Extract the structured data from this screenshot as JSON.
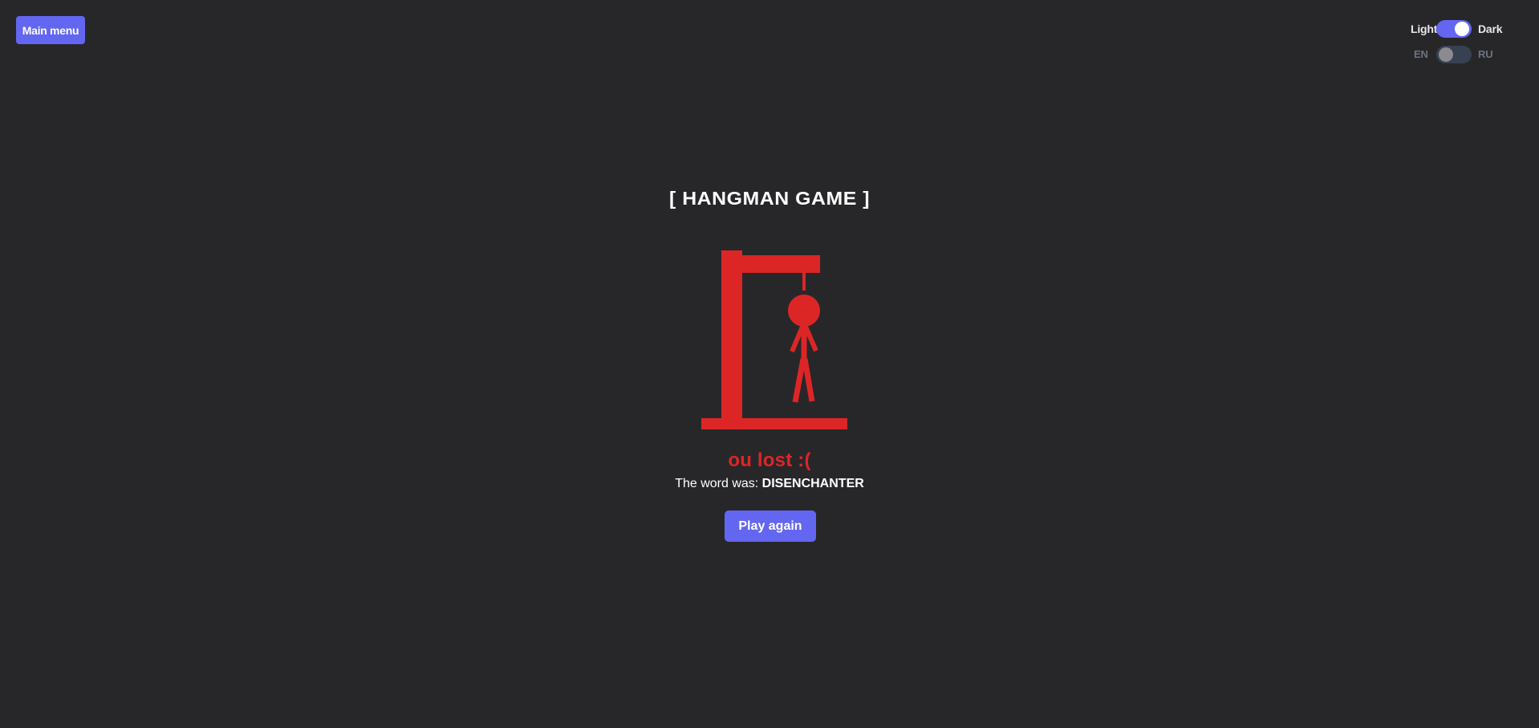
{
  "nav": {
    "main_menu_label": "Main menu"
  },
  "theme_toggle": {
    "left_label": "Light",
    "right_label": "Dark",
    "state": "dark"
  },
  "language_toggle": {
    "left_label": "EN",
    "right_label": "RU",
    "state": "en"
  },
  "game": {
    "title": "[ HANGMAN GAME ]",
    "result_message": "ou lost :(",
    "word_prefix": "The word was: ",
    "word": "DISENCHANTER",
    "play_again_label": "Play again",
    "hangman_color": "#dc2626"
  },
  "colors": {
    "background": "#27272a",
    "accent": "#6366f1",
    "danger": "#dc2626"
  }
}
